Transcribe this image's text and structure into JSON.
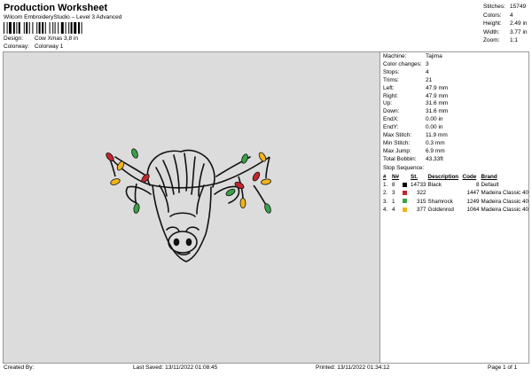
{
  "header": {
    "title": "Production Worksheet",
    "subtitle": "Wilcom EmbroideryStudio – Level 3 Advanced",
    "design_label": "Design:",
    "design_value": "Cow Xmas 3,8 in",
    "colorway_label": "Colorway:",
    "colorway_value": "Colorway 1"
  },
  "top_stats": [
    {
      "label": "Stitches:",
      "value": "15749"
    },
    {
      "label": "Colors:",
      "value": "4"
    },
    {
      "label": "Height:",
      "value": "2.49 in"
    },
    {
      "label": "Width:",
      "value": "3.77 in"
    },
    {
      "label": "Zoom:",
      "value": "1:1"
    }
  ],
  "properties": [
    {
      "label": "Machine:",
      "value": "Tajima"
    },
    {
      "label": "Color changes:",
      "value": "3"
    },
    {
      "label": "Stops:",
      "value": "4"
    },
    {
      "label": "Trims:",
      "value": "21"
    },
    {
      "label": "Left:",
      "value": "47.9 mm"
    },
    {
      "label": "Right:",
      "value": "47.9 mm"
    },
    {
      "label": "Up:",
      "value": "31.6 mm"
    },
    {
      "label": "Down:",
      "value": "31.6 mm"
    },
    {
      "label": "EndX:",
      "value": "0.00 in"
    },
    {
      "label": "EndY:",
      "value": "0.00 in"
    },
    {
      "label": "Max Stitch:",
      "value": "11.9 mm"
    },
    {
      "label": "Min Stitch:",
      "value": "0.3 mm"
    },
    {
      "label": "Max Jump:",
      "value": "6.9 mm"
    },
    {
      "label": "Total Bobbin:",
      "value": "43.33ft"
    }
  ],
  "stop_sequence": {
    "title": "Stop Sequence:",
    "headers": {
      "hash": "#",
      "n": "N#",
      "st": "St.",
      "desc": "Description",
      "code": "Code",
      "brand": "Brand"
    },
    "rows": [
      {
        "idx": "1.",
        "n": "8",
        "color": "#000000",
        "st": "14733",
        "desc": "Black",
        "code": "8",
        "brand": "Default"
      },
      {
        "idx": "2.",
        "n": "3",
        "color": "#c0282d",
        "st": "322",
        "desc": "",
        "code": "1447",
        "brand": "Madeira Classic 40"
      },
      {
        "idx": "3.",
        "n": "1",
        "color": "#3aa04a",
        "st": "315",
        "desc": "Shamrock",
        "code": "1249",
        "brand": "Madeira Classic 40"
      },
      {
        "idx": "4.",
        "n": "4",
        "color": "#f2b418",
        "st": "377",
        "desc": "Goldenrod",
        "code": "1064",
        "brand": "Madeira Classic 40"
      }
    ]
  },
  "footer": {
    "created_by": "Created By:",
    "last_saved": "Last Saved: 13/11/2022 01:08:45",
    "printed": "Printed: 13/11/2022 01:34:12",
    "page": "Page 1 of 1"
  },
  "colors": {
    "canvas_bg": "#dcdcdc",
    "thread_black": "#000000",
    "light_red": "#c0282d",
    "light_green": "#3aa04a",
    "light_yellow": "#f2b418"
  }
}
